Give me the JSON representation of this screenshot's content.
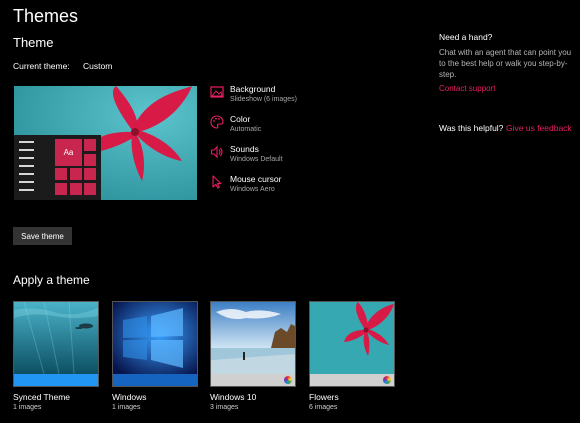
{
  "page": {
    "title": "Themes"
  },
  "theme_section": {
    "title": "Theme",
    "current_label": "Current theme:",
    "current_value": "Custom"
  },
  "preview": {
    "tile_label": "Aa"
  },
  "settings": [
    {
      "name": "Background",
      "value": "Slideshow (6 images)",
      "icon": "picture-icon"
    },
    {
      "name": "Color",
      "value": "Automatic",
      "icon": "palette-icon"
    },
    {
      "name": "Sounds",
      "value": "Windows Default",
      "icon": "speaker-icon"
    },
    {
      "name": "Mouse cursor",
      "value": "Windows Aero",
      "icon": "cursor-icon"
    }
  ],
  "save_button": "Save theme",
  "apply": {
    "title": "Apply a theme",
    "themes": [
      {
        "name": "Synced Theme",
        "count": "1 images",
        "bar_color": "#2196f3",
        "has_color_icon": false
      },
      {
        "name": "Windows",
        "count": "1 images",
        "bar_color": "#1565c0",
        "has_color_icon": false
      },
      {
        "name": "Windows 10",
        "count": "3 images",
        "bar_color": "#d0d0d0",
        "has_color_icon": true
      },
      {
        "name": "Flowers",
        "count": "6 images",
        "bar_color": "#d0d0d0",
        "has_color_icon": true
      }
    ]
  },
  "help": {
    "title": "Need a hand?",
    "text": "Chat with an agent that can point you to the best help or walk you step-by-step.",
    "link": "Contact support"
  },
  "feedback": {
    "question": "Was this helpful?",
    "link": "Give us feedback"
  },
  "colors": {
    "accent": "#e91e63",
    "background": "#000000",
    "tile": "#c8264e"
  }
}
